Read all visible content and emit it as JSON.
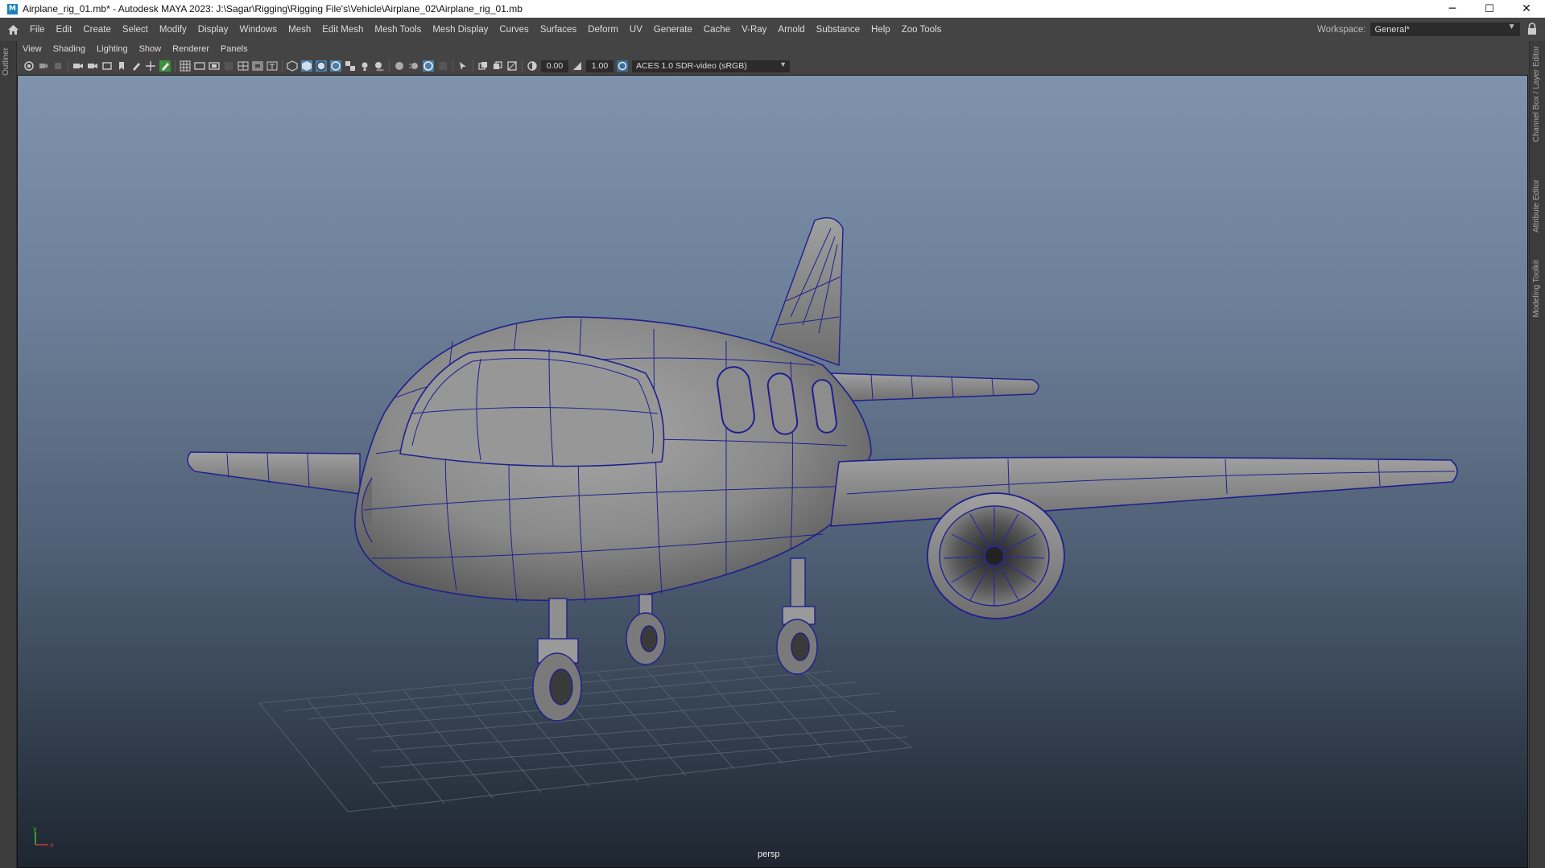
{
  "window": {
    "title": "Airplane_rig_01.mb* - Autodesk MAYA 2023: J:\\Sagar\\Rigging\\Rigging File's\\Vehicle\\Airplane_02\\Airplane_rig_01.mb",
    "app_icon_letter": "M",
    "minimize_glyph": "─",
    "maximize_glyph": "☐",
    "close_glyph": "✕"
  },
  "menubar": {
    "items": [
      "File",
      "Edit",
      "Create",
      "Select",
      "Modify",
      "Display",
      "Windows",
      "Mesh",
      "Edit Mesh",
      "Mesh Tools",
      "Mesh Display",
      "Curves",
      "Surfaces",
      "Deform",
      "UV",
      "Generate",
      "Cache",
      "V-Ray",
      "Arnold",
      "Substance",
      "Help",
      "Zoo Tools"
    ]
  },
  "workspace": {
    "label": "Workspace:",
    "value": "General*"
  },
  "left_strip": {
    "tab": "Outliner"
  },
  "right_strip": {
    "tabs": [
      "Channel Box / Layer Editor",
      "Attribute Editor",
      "Modeling Toolkit"
    ]
  },
  "panel_menu": {
    "items": [
      "View",
      "Shading",
      "Lighting",
      "Show",
      "Renderer",
      "Panels"
    ]
  },
  "panel_toolbar": {
    "exposure": "0.00",
    "gamma": "1.00",
    "color_space": "ACES 1.0 SDR-video (sRGB)"
  },
  "viewport": {
    "camera_label": "persp",
    "axis_y": "y",
    "axis_x": "x"
  },
  "colors": {
    "wireframe": "#1f1f8f",
    "ui_bg": "#444444",
    "bg_top": "#7f93ad",
    "bg_bottom": "#1e2630"
  }
}
